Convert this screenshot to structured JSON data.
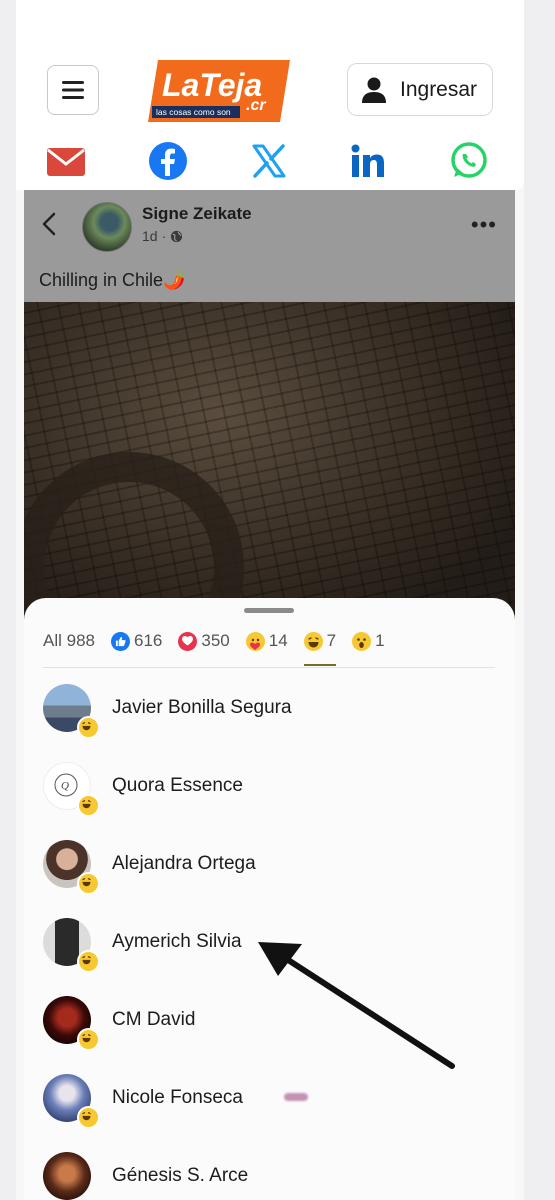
{
  "header": {
    "logo_text": "LaTeja",
    "logo_suffix": ".cr",
    "logo_tagline": "las cosas como son",
    "login_label": "Ingresar"
  },
  "share": {
    "icons": [
      "email-icon",
      "facebook-icon",
      "x-icon",
      "linkedin-icon",
      "whatsapp-icon"
    ]
  },
  "post": {
    "author": "Signe Zeikate",
    "time": "1d",
    "separator": "·",
    "caption": "Chilling in Chile🌶️"
  },
  "reactions": {
    "tabs": [
      {
        "label": "All 988",
        "icon": "none"
      },
      {
        "label": "616",
        "icon": "like-icon"
      },
      {
        "label": "350",
        "icon": "love-icon"
      },
      {
        "label": "14",
        "icon": "care-icon"
      },
      {
        "label": "7",
        "icon": "haha-icon"
      },
      {
        "label": "1",
        "icon": "wow-icon"
      }
    ],
    "active_tab": "haha",
    "people": [
      {
        "name": "Javier Bonilla Segura"
      },
      {
        "name": "Quora Essence"
      },
      {
        "name": "Alejandra Ortega"
      },
      {
        "name": "Aymerich Silvia"
      },
      {
        "name": "CM David"
      },
      {
        "name": "Nicole Fonseca"
      },
      {
        "name": "Génesis S. Arce"
      }
    ]
  },
  "colors": {
    "brand_orange": "#f26b1d",
    "email_red": "#d9483b",
    "facebook_blue": "#1877f2",
    "x_blue": "#1da1f2",
    "linkedin_blue": "#0a66c2",
    "whatsapp_green": "#25d366",
    "active_tab_underline": "#7a6b24"
  }
}
